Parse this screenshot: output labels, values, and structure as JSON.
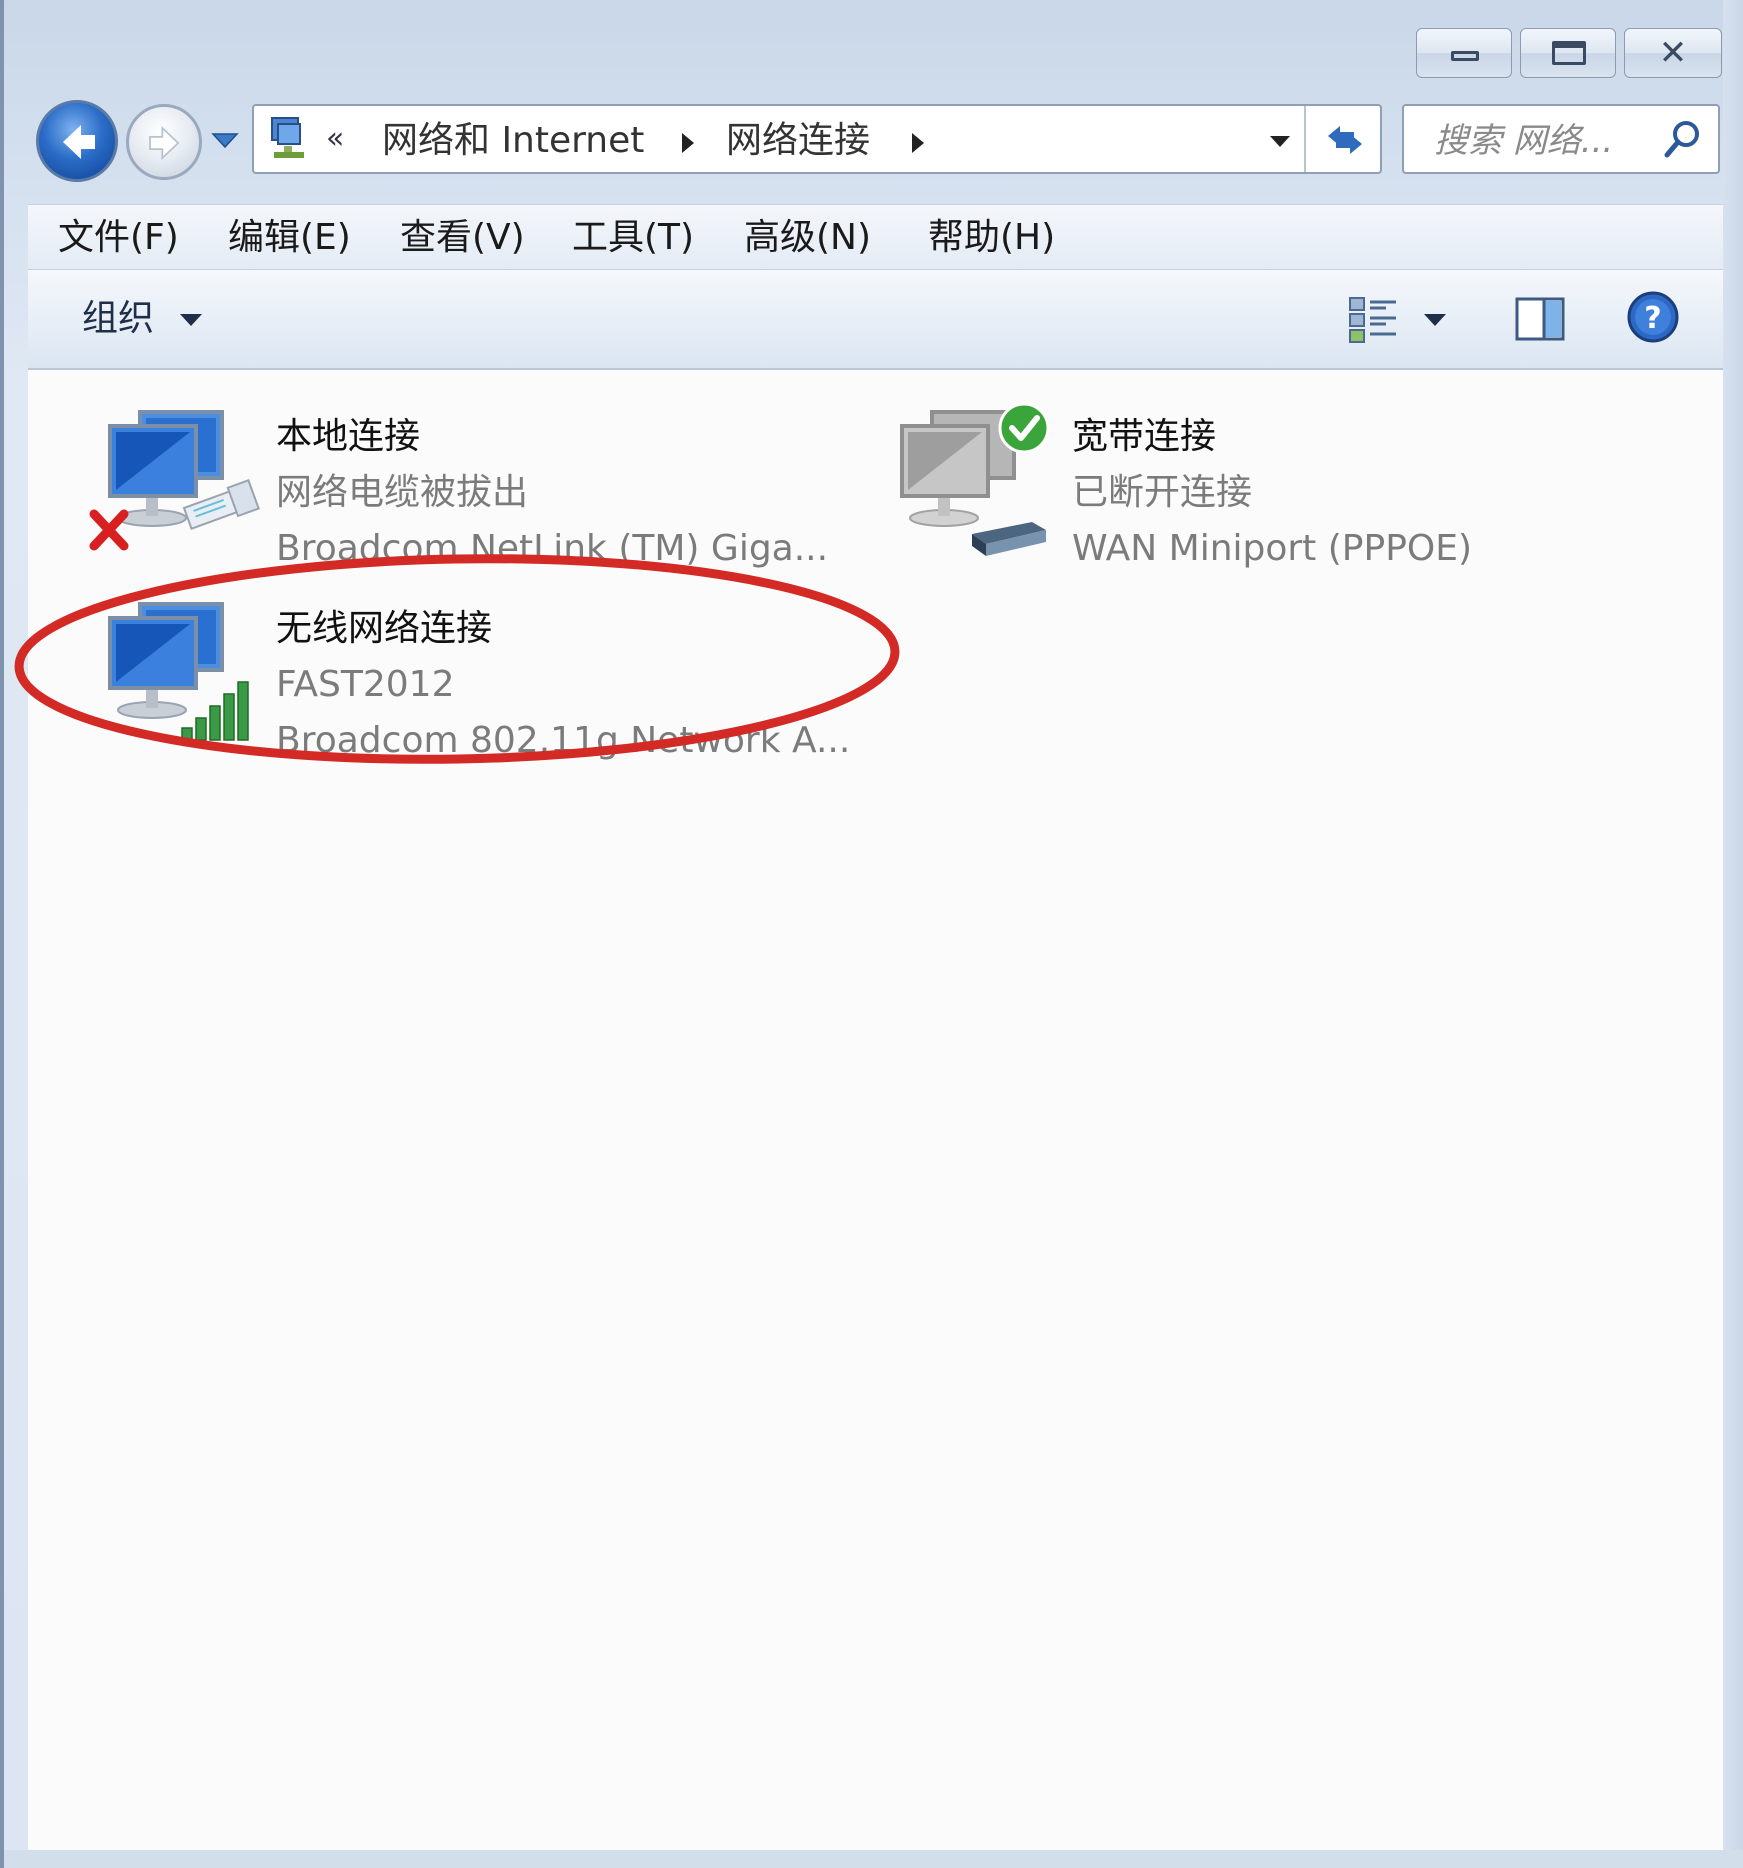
{
  "window": {
    "caption_buttons": {
      "minimize": "minimize",
      "maximize": "maximize",
      "close": "close"
    }
  },
  "navigation": {
    "breadcrumb_overflow": "«",
    "breadcrumbs": [
      "网络和 Internet",
      "网络连接"
    ],
    "search_placeholder": "搜索 网络..."
  },
  "menubar": {
    "items": [
      "文件(F)",
      "编辑(E)",
      "查看(V)",
      "工具(T)",
      "高级(N)",
      "帮助(H)"
    ]
  },
  "commandbar": {
    "organize_label": "组织"
  },
  "connections": [
    {
      "name": "本地连接",
      "status": "网络电缆被拔出",
      "device": "Broadcom NetLink (TM) Giga...",
      "icon": "lan-disconnected-icon",
      "badge": "red-x-icon"
    },
    {
      "name": "宽带连接",
      "status": "已断开连接",
      "device": "WAN Miniport (PPPOE)",
      "icon": "broadband-icon",
      "badge": "green-check-icon"
    },
    {
      "name": "无线网络连接",
      "status": "FAST2012",
      "device": "Broadcom 802.11g Network A...",
      "icon": "wireless-icon",
      "badge": "signal-bars-icon",
      "signal_level": 5
    }
  ],
  "annotation": {
    "highlight_color": "#d42a25",
    "target": "无线网络连接"
  },
  "colors": {
    "accent_blue": "#2b6dc8",
    "text_gray": "#7b7b7b",
    "highlight_red": "#d42a25",
    "check_green": "#3aa53a"
  }
}
